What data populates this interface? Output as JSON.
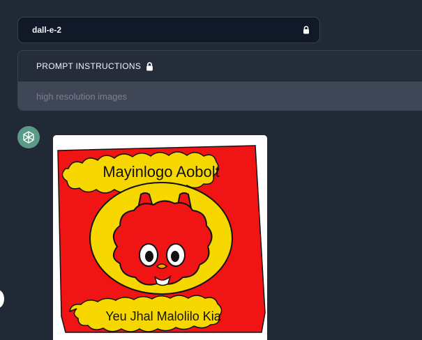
{
  "model_select": {
    "value": "dall-e-2",
    "icon": "lock-icon"
  },
  "instructions": {
    "title": "PROMPT INSTRUCTIONS",
    "icon": "lock-icon",
    "placeholder": "high resolution images"
  },
  "message": {
    "avatar_icon": "openai-logo-icon",
    "image": {
      "top_text": "Mayinlogo Aobolt",
      "bottom_text": "Yeu Jhal Malolilo Kia"
    }
  },
  "colors": {
    "background": "#212936",
    "panel": "#111827",
    "input_bg": "#3f4655",
    "avatar": "#5c9a88",
    "poster_red": "#f01414",
    "poster_yellow": "#f6d800"
  }
}
